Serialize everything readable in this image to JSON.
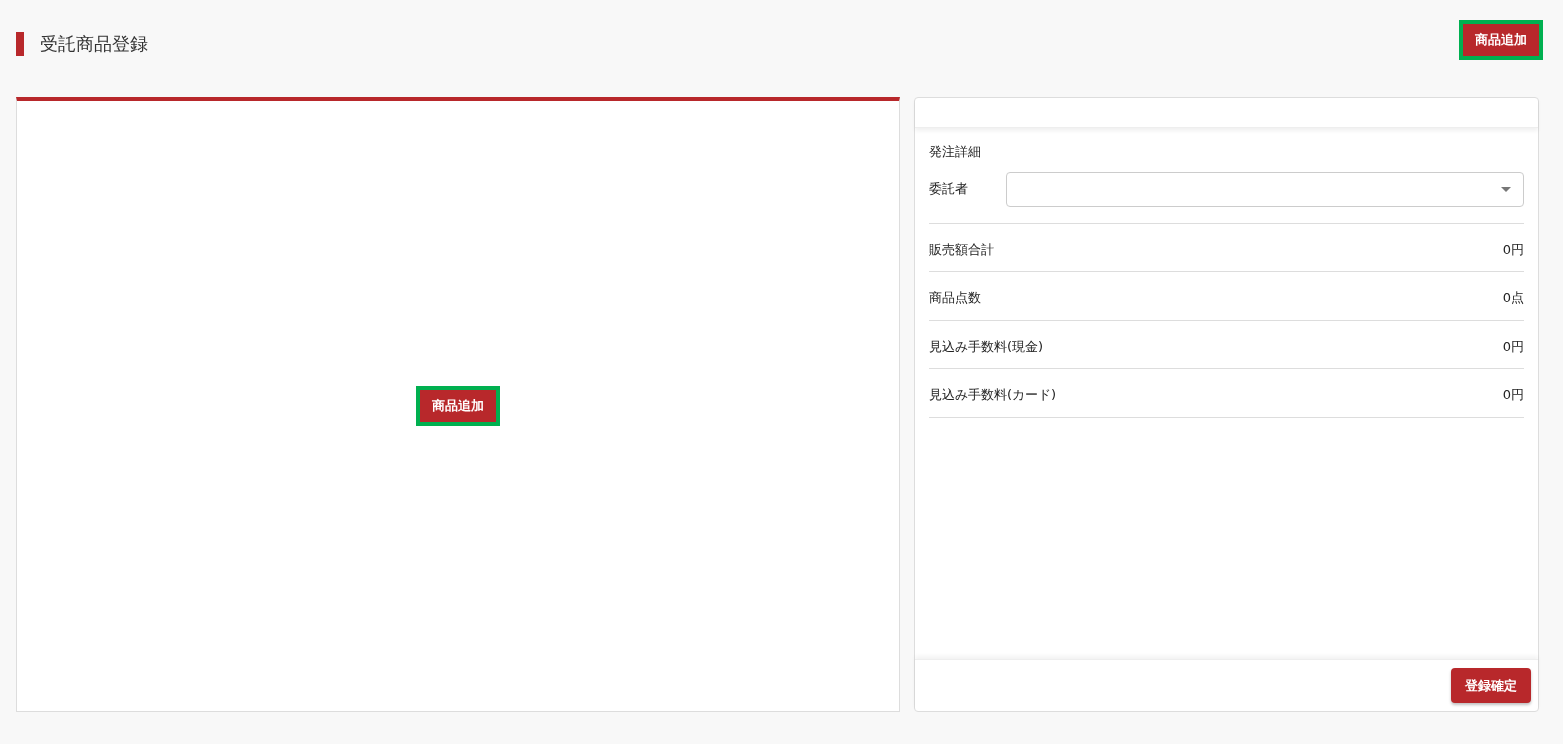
{
  "page_title": "受託商品登録",
  "header_button": {
    "label": "商品追加",
    "highlighted": true
  },
  "item_panel": {
    "add_button": {
      "label": "商品追加",
      "highlighted": true
    }
  },
  "order_panel": {
    "section_title": "発注詳細",
    "consignor": {
      "label": "委託者"
    },
    "summary": [
      {
        "label": "販売額合計",
        "value": "0円"
      },
      {
        "label": "商品点数",
        "value": "0点"
      },
      {
        "label": "見込み手数料(現金)",
        "value": "0円"
      },
      {
        "label": "見込み手数料(カード)",
        "value": "0円"
      }
    ],
    "confirm_button": {
      "label": "登録確定"
    }
  }
}
